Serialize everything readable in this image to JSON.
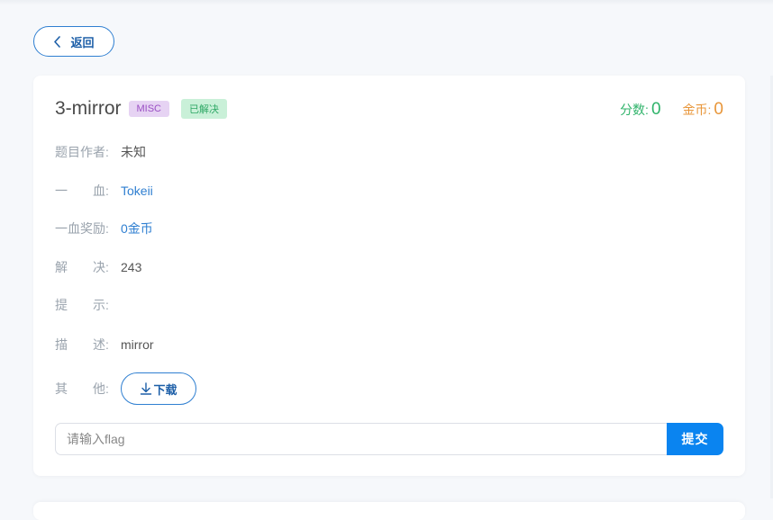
{
  "back_button": {
    "label": "返回"
  },
  "challenge": {
    "title": "3-mirror",
    "category_tag": "MISC",
    "status_tag": "已解决",
    "score_label": "分数:",
    "score_value": "0",
    "coin_label": "金币:",
    "coin_value": "0"
  },
  "info_rows": [
    {
      "label": "题目作者:",
      "value": "未知"
    },
    {
      "label": "一　　血:",
      "value": "Tokeii"
    },
    {
      "label": "一血奖励:",
      "value": "0金币"
    },
    {
      "label": "解　　决:",
      "value": "243"
    },
    {
      "label": "提　　示:",
      "value": ""
    },
    {
      "label": "描　　述:",
      "value": "mirror"
    },
    {
      "label": "其　　他:",
      "value": ""
    }
  ],
  "download_button": {
    "label": "下载",
    "icon": "download-icon"
  },
  "flag_form": {
    "placeholder": "请输入flag",
    "value": "",
    "submit_label": "提交"
  },
  "colors": {
    "accent": "#0a84f0",
    "link": "#2f7fd1",
    "score": "#2fb36a",
    "coin": "#e8963a",
    "misc_tag_bg": "#e6d3f3",
    "solved_tag_bg": "#c9f0d8"
  }
}
